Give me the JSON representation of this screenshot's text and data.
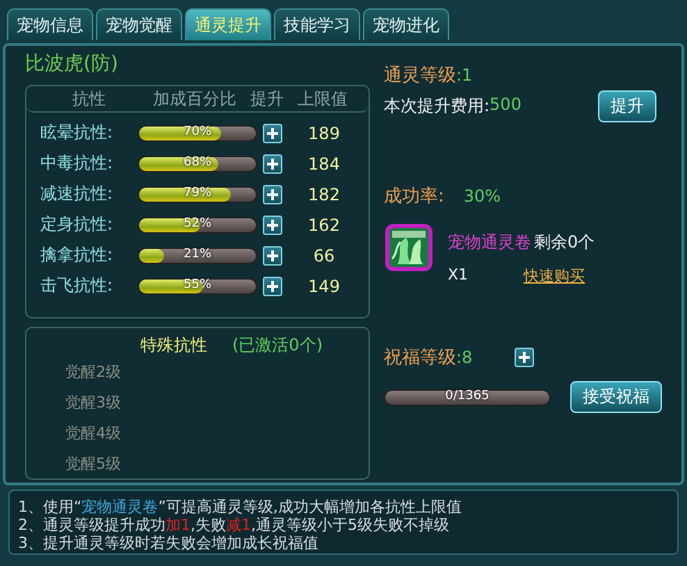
{
  "tabs": [
    {
      "label": "宠物信息",
      "selected": false
    },
    {
      "label": "宠物觉醒",
      "selected": false
    },
    {
      "label": "通灵提升",
      "selected": true
    },
    {
      "label": "技能学习",
      "selected": false
    },
    {
      "label": "宠物进化",
      "selected": false
    }
  ],
  "pet_name": "比波虎(防)",
  "resist_table": {
    "columns": [
      "抗性",
      "加成百分比",
      "提升",
      "上限值"
    ],
    "rows": [
      {
        "name": "眩晕抗性:",
        "level": 0.7,
        "reading": "70%",
        "limit": "189"
      },
      {
        "name": "中毒抗性:",
        "level": 0.68,
        "reading": "68%",
        "limit": "184"
      },
      {
        "name": "减速抗性:",
        "level": 0.79,
        "reading": "79%",
        "limit": "182"
      },
      {
        "name": "定身抗性:",
        "level": 0.52,
        "reading": "52%",
        "limit": "162"
      },
      {
        "name": "擒拿抗性:",
        "level": 0.21,
        "reading": "21%",
        "limit": "66"
      },
      {
        "name": "击飞抗性:",
        "level": 0.55,
        "reading": "55%",
        "limit": "149"
      }
    ]
  },
  "special": {
    "title": "特殊抗性",
    "status": "(已激活0个)",
    "items": [
      {
        "label": "觉醒2级",
        "active": false
      },
      {
        "label": "觉醒3级",
        "active": false
      },
      {
        "label": "觉醒4级",
        "active": false
      },
      {
        "label": "觉醒5级",
        "active": false
      }
    ]
  },
  "upgrade": {
    "level_label": "通灵等级",
    "level_value": ":1",
    "cost_label": "本次提升费用:",
    "cost_value": "500",
    "button": "提升",
    "rate_label": "成功率:",
    "rate_value": "30%",
    "item_name": "宠物通灵卷",
    "item_remaining": "剩余0个",
    "item_count": "X1",
    "buy_link": "快速购买"
  },
  "blessing": {
    "label": "祝福等级",
    "value": ":8",
    "level": 0,
    "reading": "0/1365",
    "button": "接受祝福"
  },
  "notes": [
    [
      {
        "text": "1、使用“",
        "kind": "plain"
      },
      {
        "text": "宠物通灵卷",
        "kind": "highlight"
      },
      {
        "text": "”可提高通灵等级,成功大幅增加各抗性上限值",
        "kind": "plain"
      }
    ],
    [
      {
        "text": "2、通灵等级提升成功",
        "kind": "plain"
      },
      {
        "text": "加1",
        "kind": "warn"
      },
      {
        "text": ",失败",
        "kind": "plain"
      },
      {
        "text": "减1",
        "kind": "warn"
      },
      {
        "text": ",通灵等级小于5级失败不掉级",
        "kind": "plain"
      }
    ],
    [
      {
        "text": "3、提升通灵等级时若失败会增加成长祝福值",
        "kind": "plain"
      }
    ]
  ]
}
